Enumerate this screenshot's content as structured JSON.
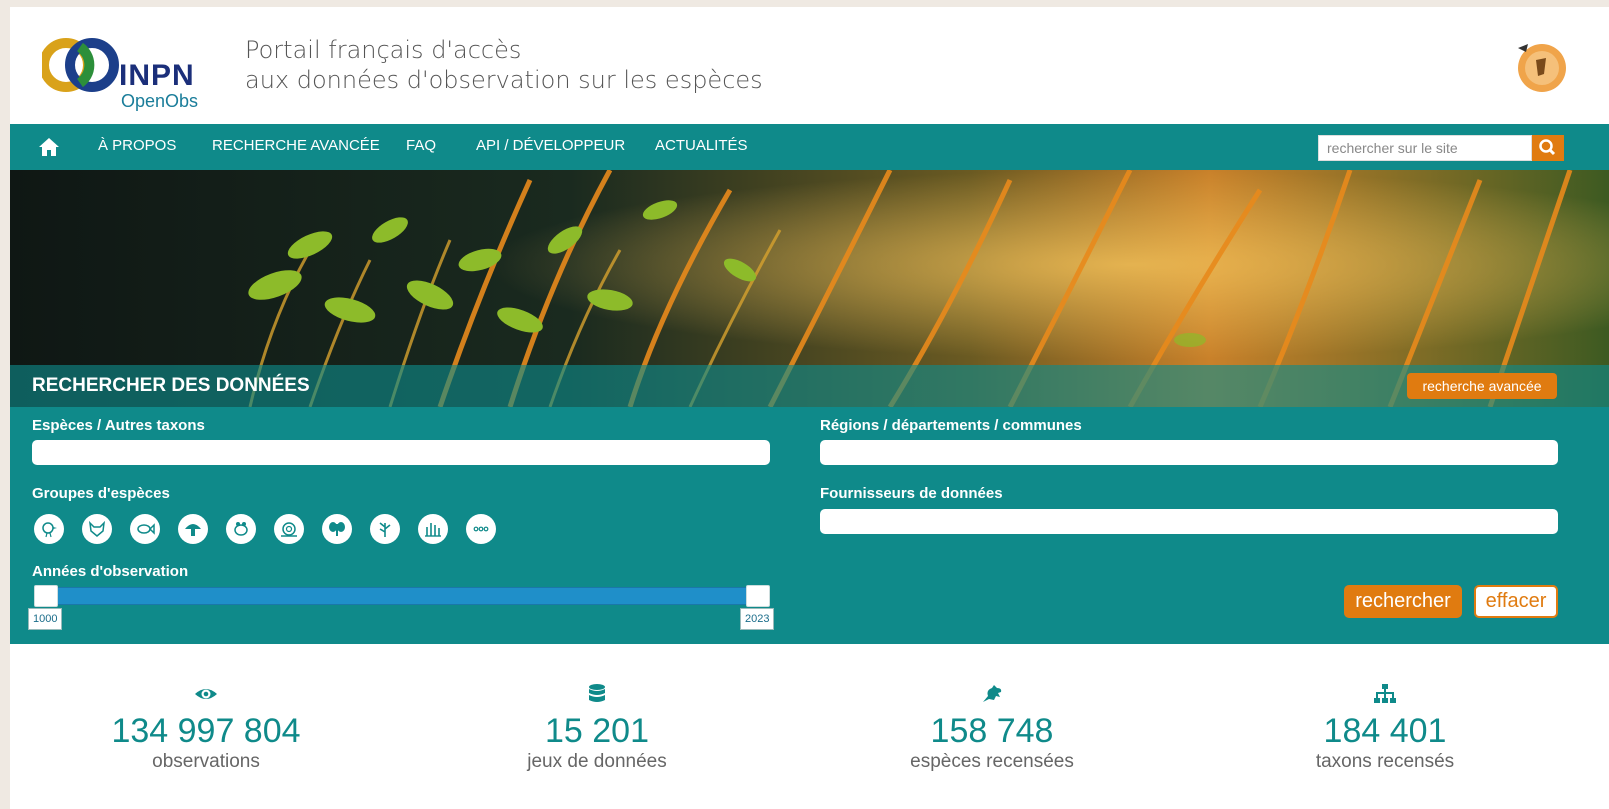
{
  "header": {
    "logo_word": "INPN",
    "logo_sub": "OpenObs",
    "tagline_line1": "Portail français d'accès",
    "tagline_line2": "aux données d'observation sur les espèces"
  },
  "nav": {
    "items": [
      "À PROPOS",
      "RECHERCHE AVANCÉE",
      "FAQ",
      "API / DÉVELOPPEUR",
      "ACTUALITÉS"
    ],
    "search_placeholder": "rechercher sur le site"
  },
  "search": {
    "title": "RECHERCHER DES DONNÉES",
    "advanced_label": "recherche avancée",
    "species_label": "Espèces / Autres taxons",
    "regions_label": "Régions / départements / communes",
    "groups_label": "Groupes d'espèces",
    "providers_label": "Fournisseurs de données",
    "years_label": "Années d'observation",
    "year_min": "1000",
    "year_max": "2023",
    "search_button": "rechercher",
    "clear_button": "effacer"
  },
  "groups": [
    "bird-icon",
    "mammal-icon",
    "fish-icon",
    "mushroom-icon",
    "amphibian-icon",
    "snail-icon",
    "insect-icon",
    "plant-icon",
    "moss-icon",
    "more-icon"
  ],
  "stats": [
    {
      "icon": "eye-icon",
      "value": "134 997 804",
      "label": "observations"
    },
    {
      "icon": "database-icon",
      "value": "15 201",
      "label": "jeux de données"
    },
    {
      "icon": "frog-icon",
      "value": "158 748",
      "label": "espèces recensées"
    },
    {
      "icon": "sitemap-icon",
      "value": "184 401",
      "label": "taxons recensés"
    }
  ],
  "colors": {
    "teal": "#0f8a8a",
    "orange": "#e07b10",
    "slider": "#1f8fc9"
  }
}
